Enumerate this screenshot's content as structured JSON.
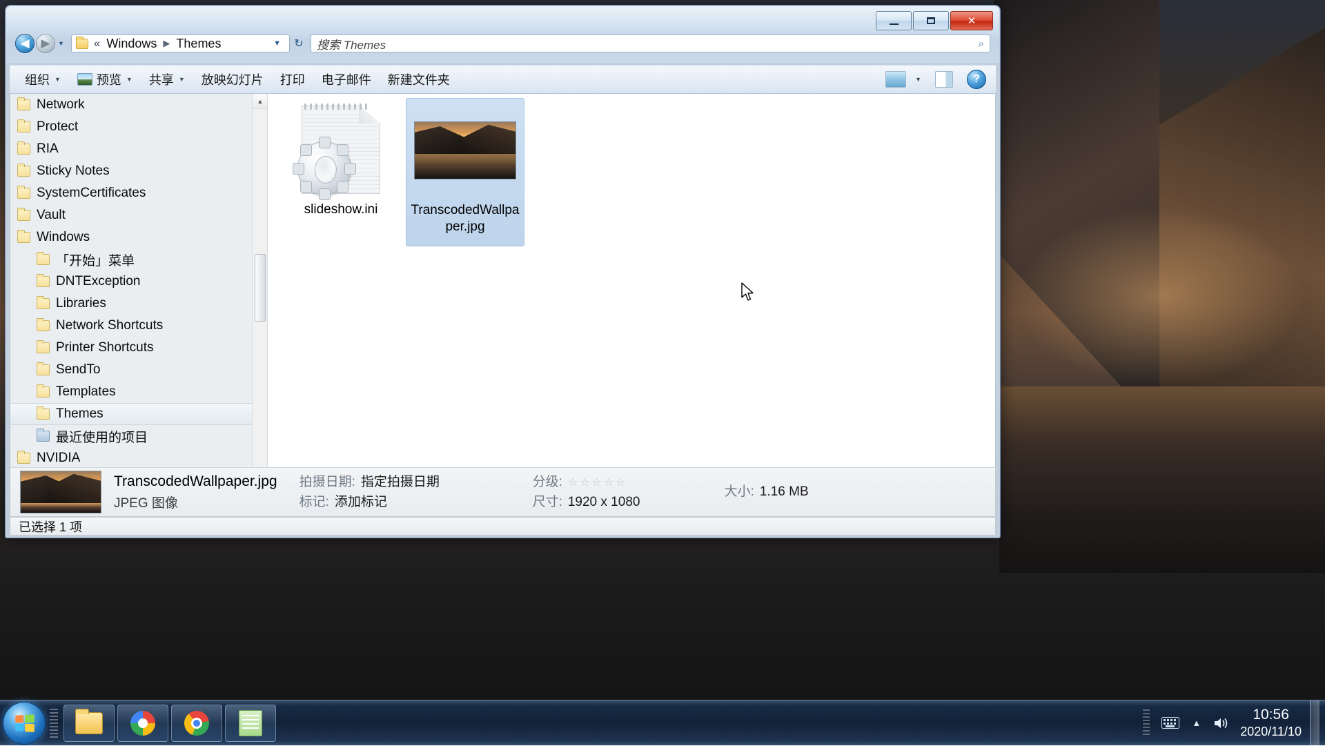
{
  "window": {
    "caption_buttons": {
      "minimize": "minimize-icon",
      "maximize": "maximize-icon",
      "close": "✕"
    }
  },
  "address_bar": {
    "back_glyph": "◀",
    "forward_glyph": "▶",
    "history_caret": "▼",
    "leading_chevron": "«",
    "crumbs": [
      "Windows",
      "Themes"
    ],
    "separator": "▶",
    "dropdown_caret": "▼",
    "refresh_glyph": "↻"
  },
  "search": {
    "placeholder": "搜索 Themes",
    "icon": "search-icon",
    "glyph": "⌕"
  },
  "toolbar": {
    "organize": "组织",
    "preview": "预览",
    "share": "共享",
    "slideshow": "放映幻灯片",
    "print": "打印",
    "email": "电子邮件",
    "new_folder": "新建文件夹",
    "caret": "▼",
    "view_icon": "view-layout-icon",
    "pane_icon": "preview-pane-icon",
    "help_label": "?"
  },
  "tree": {
    "items": [
      {
        "label": "Network",
        "indent": 1,
        "selected": false,
        "icon": "folder-icon"
      },
      {
        "label": "Protect",
        "indent": 1,
        "selected": false,
        "icon": "folder-icon"
      },
      {
        "label": "RIA",
        "indent": 1,
        "selected": false,
        "icon": "folder-icon"
      },
      {
        "label": "Sticky Notes",
        "indent": 1,
        "selected": false,
        "icon": "folder-icon"
      },
      {
        "label": "SystemCertificates",
        "indent": 1,
        "selected": false,
        "icon": "folder-icon"
      },
      {
        "label": "Vault",
        "indent": 1,
        "selected": false,
        "icon": "folder-icon"
      },
      {
        "label": "Windows",
        "indent": 1,
        "selected": false,
        "icon": "folder-icon"
      },
      {
        "label": "「开始」菜单",
        "indent": 2,
        "selected": false,
        "icon": "folder-icon"
      },
      {
        "label": "DNTException",
        "indent": 2,
        "selected": false,
        "icon": "folder-icon"
      },
      {
        "label": "Libraries",
        "indent": 2,
        "selected": false,
        "icon": "folder-icon"
      },
      {
        "label": "Network Shortcuts",
        "indent": 2,
        "selected": false,
        "icon": "folder-icon"
      },
      {
        "label": "Printer Shortcuts",
        "indent": 2,
        "selected": false,
        "icon": "folder-icon"
      },
      {
        "label": "SendTo",
        "indent": 2,
        "selected": false,
        "icon": "folder-icon"
      },
      {
        "label": "Templates",
        "indent": 2,
        "selected": false,
        "icon": "folder-icon"
      },
      {
        "label": "Themes",
        "indent": 2,
        "selected": true,
        "icon": "folder-icon"
      },
      {
        "label": "最近使用的项目",
        "indent": 2,
        "selected": false,
        "icon": "recent-items-icon"
      },
      {
        "label": "NVIDIA",
        "indent": 1,
        "selected": false,
        "icon": "folder-icon"
      }
    ],
    "scroll_up_glyph": "▲",
    "scroll_down_glyph": "▼"
  },
  "files": [
    {
      "name": "slideshow.ini",
      "icon": "ini-file-icon",
      "selected": false
    },
    {
      "name": "TranscodedWallpaper.jpg",
      "icon": "image-thumbnail",
      "selected": true
    }
  ],
  "details": {
    "file_name": "TranscodedWallpaper.jpg",
    "file_type": "JPEG 图像",
    "date_taken_key": "拍摄日期:",
    "date_taken_value": "指定拍摄日期",
    "tags_key": "标记:",
    "tags_value": "添加标记",
    "rating_key": "分级:",
    "rating_stars": 5,
    "rating_filled": 0,
    "dimensions_key": "尺寸:",
    "dimensions_value": "1920 x 1080",
    "size_key": "大小:",
    "size_value": "1.16 MB"
  },
  "status_bar": {
    "text": "已选择 1 项"
  },
  "taskbar": {
    "start_icon": "windows-orb-icon",
    "buttons": [
      {
        "icon": "explorer-icon",
        "name": "taskbar-explorer"
      },
      {
        "icon": "chrome-old-icon",
        "name": "taskbar-browser-1"
      },
      {
        "icon": "chrome-icon",
        "name": "taskbar-browser-2"
      },
      {
        "icon": "notes-icon",
        "name": "taskbar-notes"
      }
    ],
    "tray": {
      "keyboard_icon": "keyboard-icon",
      "expand_glyph": "▲",
      "volume_icon": "volume-icon",
      "volume_glyph": "🔊"
    },
    "clock": {
      "time": "10:56",
      "date": "2020/11/10"
    }
  }
}
